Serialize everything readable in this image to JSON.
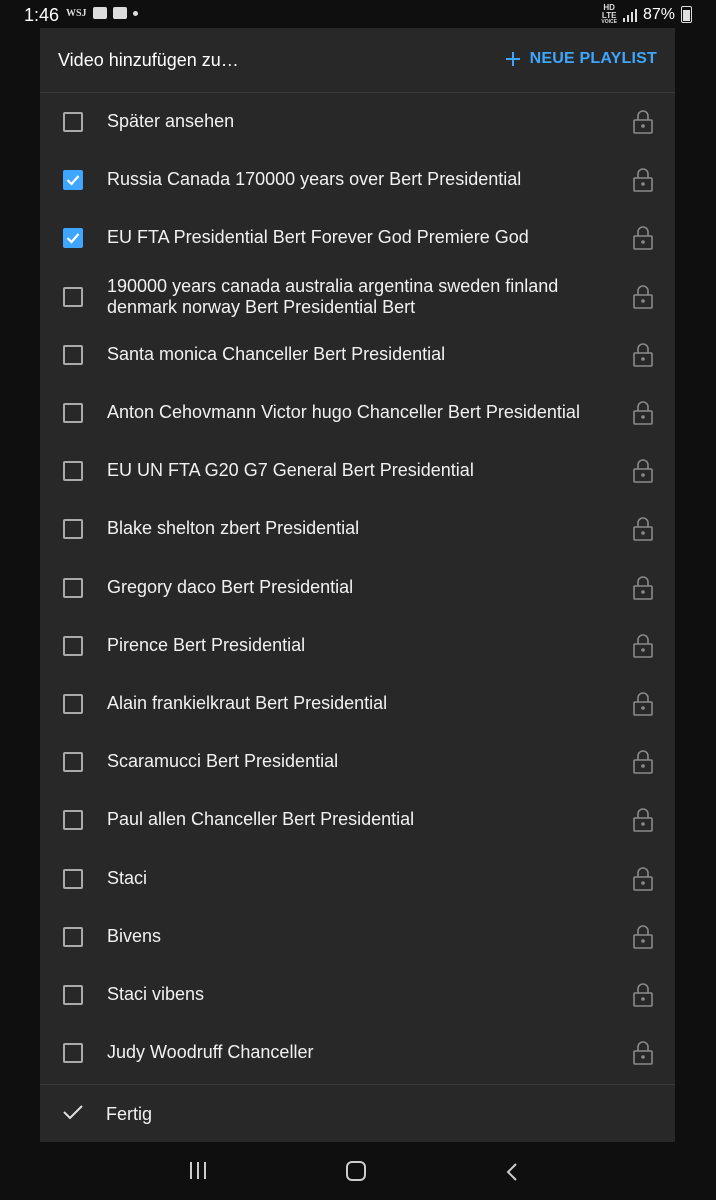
{
  "status_bar": {
    "time": "1:46",
    "notif_text": "WSJ",
    "network_top": "HD",
    "network_mid": "LTE",
    "network_bottom": "VOICE",
    "battery_pct": "87%"
  },
  "dialog": {
    "title": "Video hinzufügen zu…",
    "new_playlist_label": "NEUE PLAYLIST",
    "accent_color": "#3ea6ff",
    "items": [
      {
        "label": "Später ansehen",
        "checked": false,
        "private": true
      },
      {
        "label": "Russia Canada 170000 years over Bert Presidential",
        "checked": true,
        "private": true
      },
      {
        "label": "EU FTA Presidential Bert Forever God Premiere God",
        "checked": true,
        "private": true
      },
      {
        "label": "190000 years canada australia argentina sweden finland denmark norway Bert Presidential Bert",
        "checked": false,
        "private": true
      },
      {
        "label": "Santa monica Chanceller Bert Presidential",
        "checked": false,
        "private": true
      },
      {
        "label": "Anton Cehovmann Victor hugo Chanceller Bert Presidential",
        "checked": false,
        "private": true
      },
      {
        "label": "EU UN FTA G20 G7 General Bert Presidential",
        "checked": false,
        "private": true
      },
      {
        "label": "Blake shelton zbert Presidential",
        "checked": false,
        "private": true
      },
      {
        "label": "Gregory daco Bert Presidential",
        "checked": false,
        "private": true
      },
      {
        "label": "Pirence Bert Presidential",
        "checked": false,
        "private": true
      },
      {
        "label": "Alain frankielkraut Bert Presidential",
        "checked": false,
        "private": true
      },
      {
        "label": "Scaramucci Bert Presidential",
        "checked": false,
        "private": true
      },
      {
        "label": "Paul allen Chanceller Bert Presidential",
        "checked": false,
        "private": true
      },
      {
        "label": "Staci",
        "checked": false,
        "private": true
      },
      {
        "label": "Bivens",
        "checked": false,
        "private": true
      },
      {
        "label": "Staci vibens",
        "checked": false,
        "private": true
      },
      {
        "label": "Judy Woodruff Chanceller",
        "checked": false,
        "private": true
      }
    ],
    "done_label": "Fertig"
  }
}
